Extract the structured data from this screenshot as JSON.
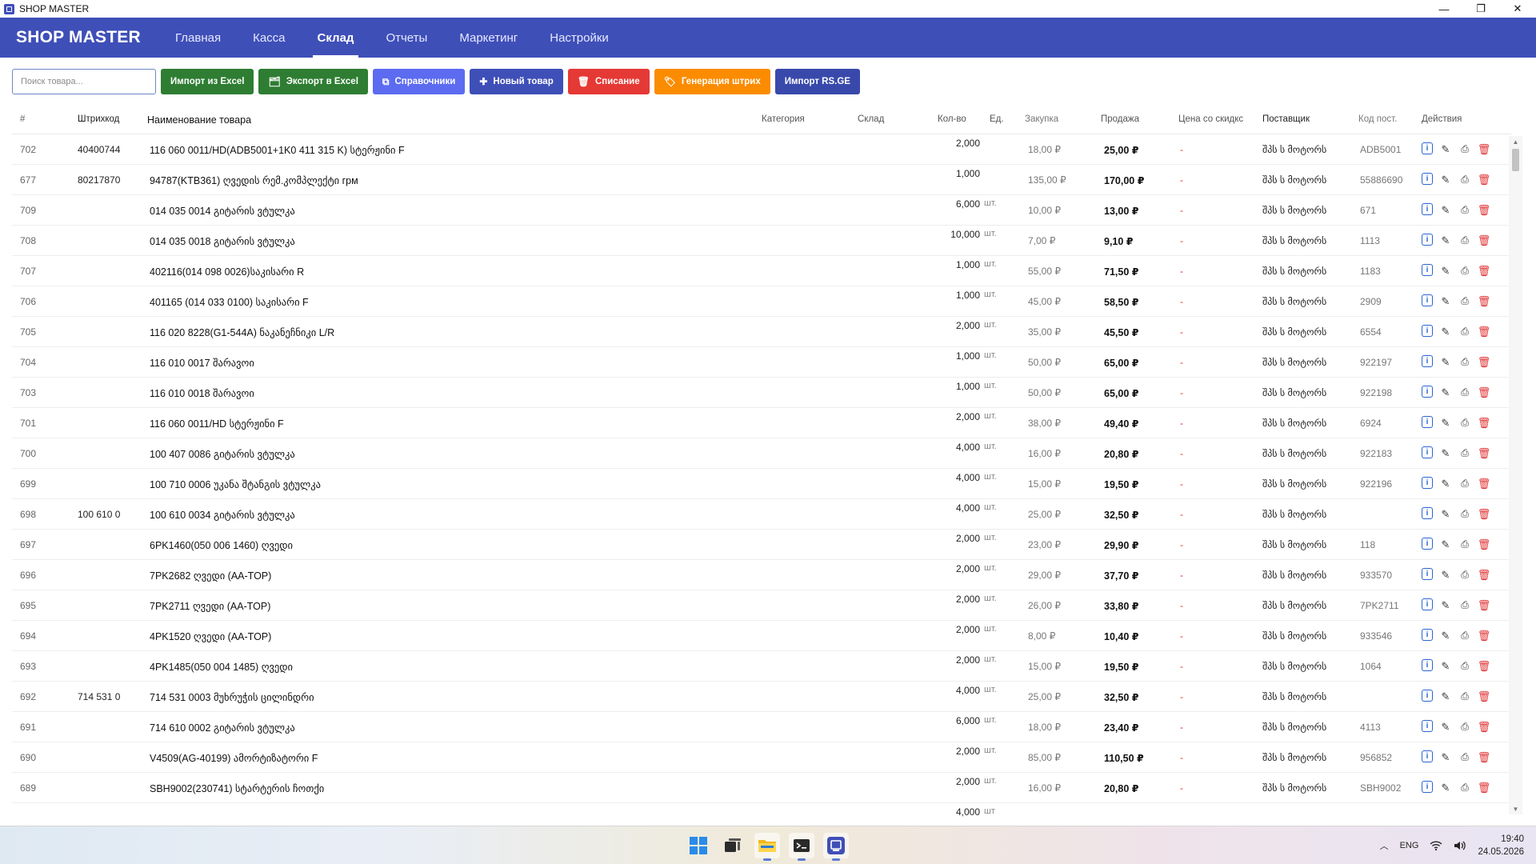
{
  "window": {
    "title": "SHOP MASTER",
    "min": "—",
    "max": "❐",
    "close": "✕"
  },
  "nav": {
    "brand": "SHOP MASTER",
    "items": [
      {
        "label": "Главная",
        "active": false
      },
      {
        "label": "Касса",
        "active": false
      },
      {
        "label": "Склад",
        "active": true
      },
      {
        "label": "Отчеты",
        "active": false
      },
      {
        "label": "Маркетинг",
        "active": false
      },
      {
        "label": "Настройки",
        "active": false
      }
    ]
  },
  "toolbar": {
    "search_placeholder": "Поиск товара...",
    "buttons": [
      {
        "label": "Импорт из Excel",
        "icon": "",
        "color": "#2e7d32"
      },
      {
        "label": "Экспорт в Excel",
        "icon": "🗂",
        "color": "#2e7d32"
      },
      {
        "label": "Справочники",
        "icon": "⧉",
        "color": "#5c6bf0"
      },
      {
        "label": "Новый товар",
        "icon": "✚",
        "color": "#3f4fb8"
      },
      {
        "label": "Списание",
        "icon": "🗑",
        "color": "#e53935"
      },
      {
        "label": "Генерация штрих",
        "icon": "🏷",
        "color": "#fb8c00"
      },
      {
        "label": "Импорт RS.GE",
        "icon": "",
        "color": "#3949ab"
      }
    ]
  },
  "table": {
    "columns": {
      "id": "#",
      "barcode": "Штрихкод",
      "name": "Наименование товара",
      "category": "Категория",
      "warehouse": "Склад",
      "qty": "Кол-во",
      "unit": "Ед.",
      "buy": "Закупка",
      "sell": "Продажа",
      "discount": "Цена со скидкс",
      "supplier": "Поставщик",
      "code": "Код пост.",
      "actions": "Действия"
    },
    "rows": [
      {
        "id": "702",
        "barcode": "40400744",
        "name": "116 060 0011/HD(ADB5001+1K0 411 315 K) სტერჟინი F",
        "qty": "2,000",
        "unit": "",
        "buy": "18,00 ₽",
        "sell": "25,00 ₽",
        "disc": "-",
        "supplier": "შპს ს მოტორს",
        "code": "ADB5001"
      },
      {
        "id": "677",
        "barcode": "80217870",
        "name": "94787(KTB361) ღვედის რემ.კომპლექტი грм",
        "qty": "1,000",
        "unit": "",
        "buy": "135,00 ₽",
        "sell": "170,00 ₽",
        "disc": "-",
        "supplier": "შპს ს მოტორს",
        "code": "55886690"
      },
      {
        "id": "709",
        "barcode": "",
        "name": "014 035 0014 გიტარის ვტულკა",
        "qty": "6,000",
        "unit": "шт.",
        "buy": "10,00 ₽",
        "sell": "13,00 ₽",
        "disc": "-",
        "supplier": "შპს ს მოტორს",
        "code": "671"
      },
      {
        "id": "708",
        "barcode": "",
        "name": "014 035 0018 გიტარის ვტულკა",
        "qty": "10,000",
        "unit": "шт.",
        "buy": "7,00 ₽",
        "sell": "9,10 ₽",
        "disc": "-",
        "supplier": "შპს ს მოტორს",
        "code": "1113"
      },
      {
        "id": "707",
        "barcode": "",
        "name": "402116(014 098 0026)საკისარი R",
        "qty": "1,000",
        "unit": "шт.",
        "buy": "55,00 ₽",
        "sell": "71,50 ₽",
        "disc": "-",
        "supplier": "შპს ს მოტორს",
        "code": "1183"
      },
      {
        "id": "706",
        "barcode": "",
        "name": "401165 (014 033 0100) საკისარი F",
        "qty": "1,000",
        "unit": "шт.",
        "buy": "45,00 ₽",
        "sell": "58,50 ₽",
        "disc": "-",
        "supplier": "შპს ს მოტორს",
        "code": "2909"
      },
      {
        "id": "705",
        "barcode": "",
        "name": "116 020 8228(G1-544A) ნაკანეჩნიკი L/R",
        "qty": "2,000",
        "unit": "шт.",
        "buy": "35,00 ₽",
        "sell": "45,50 ₽",
        "disc": "-",
        "supplier": "შპს ს მოტორს",
        "code": "6554"
      },
      {
        "id": "704",
        "barcode": "",
        "name": "116 010 0017 შარავოი",
        "qty": "1,000",
        "unit": "шт.",
        "buy": "50,00 ₽",
        "sell": "65,00 ₽",
        "disc": "-",
        "supplier": "შპს ს მოტორს",
        "code": "922197"
      },
      {
        "id": "703",
        "barcode": "",
        "name": "116 010 0018 შარავოი",
        "qty": "1,000",
        "unit": "шт.",
        "buy": "50,00 ₽",
        "sell": "65,00 ₽",
        "disc": "-",
        "supplier": "შპს ს მოტორს",
        "code": "922198"
      },
      {
        "id": "701",
        "barcode": "",
        "name": "116 060 0011/HD სტერჟინი F",
        "qty": "2,000",
        "unit": "шт.",
        "buy": "38,00 ₽",
        "sell": "49,40 ₽",
        "disc": "-",
        "supplier": "შპს ს მოტორს",
        "code": "6924"
      },
      {
        "id": "700",
        "barcode": "",
        "name": "100 407 0086 გიტარის ვტულკა",
        "qty": "4,000",
        "unit": "шт.",
        "buy": "16,00 ₽",
        "sell": "20,80 ₽",
        "disc": "-",
        "supplier": "შპს ს მოტორს",
        "code": "922183"
      },
      {
        "id": "699",
        "barcode": "",
        "name": "100 710 0006 უკანა შტანგის ვტულკა",
        "qty": "4,000",
        "unit": "шт.",
        "buy": "15,00 ₽",
        "sell": "19,50 ₽",
        "disc": "-",
        "supplier": "შპს ს მოტორს",
        "code": "922196"
      },
      {
        "id": "698",
        "barcode": "100 610 0",
        "name": "100 610 0034  გიტარის ვტულკა",
        "qty": "4,000",
        "unit": "шт.",
        "buy": "25,00 ₽",
        "sell": "32,50 ₽",
        "disc": "-",
        "supplier": "შპს ს მოტორს",
        "code": ""
      },
      {
        "id": "697",
        "barcode": "",
        "name": "6PK1460(050 006 1460) ღვედი",
        "qty": "2,000",
        "unit": "шт.",
        "buy": "23,00 ₽",
        "sell": "29,90 ₽",
        "disc": "-",
        "supplier": "შპს ს მოტორს",
        "code": "118"
      },
      {
        "id": "696",
        "barcode": "",
        "name": "7PK2682 ღვედი (AA-TOP)",
        "qty": "2,000",
        "unit": "шт.",
        "buy": "29,00 ₽",
        "sell": "37,70 ₽",
        "disc": "-",
        "supplier": "შპს ს მოტორს",
        "code": "933570"
      },
      {
        "id": "695",
        "barcode": "",
        "name": "7PK2711 ღვედი (AA-TOP)",
        "qty": "2,000",
        "unit": "шт.",
        "buy": "26,00 ₽",
        "sell": "33,80 ₽",
        "disc": "-",
        "supplier": "შპს ს მოტორს",
        "code": "7PK2711"
      },
      {
        "id": "694",
        "barcode": "",
        "name": "4PK1520 ღვედი (AA-TOP)",
        "qty": "2,000",
        "unit": "шт.",
        "buy": "8,00 ₽",
        "sell": "10,40 ₽",
        "disc": "-",
        "supplier": "შპს ს მოტორს",
        "code": "933546"
      },
      {
        "id": "693",
        "barcode": "",
        "name": "4PK1485(050 004 1485) ღვედი",
        "qty": "2,000",
        "unit": "шт.",
        "buy": "15,00 ₽",
        "sell": "19,50 ₽",
        "disc": "-",
        "supplier": "შპს ს მოტორს",
        "code": "1064"
      },
      {
        "id": "692",
        "barcode": "714 531 0",
        "name": "714 531 0003 მუხრუჭის ცილინდრი",
        "qty": "4,000",
        "unit": "шт.",
        "buy": "25,00 ₽",
        "sell": "32,50 ₽",
        "disc": "-",
        "supplier": "შპს ს მოტორს",
        "code": ""
      },
      {
        "id": "691",
        "barcode": "",
        "name": "714 610 0002 გიტარის ვტულკა",
        "qty": "6,000",
        "unit": "шт.",
        "buy": "18,00 ₽",
        "sell": "23,40 ₽",
        "disc": "-",
        "supplier": "შპს ს მოტორს",
        "code": "4113"
      },
      {
        "id": "690",
        "barcode": "",
        "name": "V4509(AG-40199) ამორტიზატორი F",
        "qty": "2,000",
        "unit": "шт.",
        "buy": "85,00 ₽",
        "sell": "110,50 ₽",
        "disc": "-",
        "supplier": "შპს ს მოტორს",
        "code": "956852"
      },
      {
        "id": "689",
        "barcode": "",
        "name": "SBH9002(230741) სტარტერის ჩოთქი",
        "qty": "2,000",
        "unit": "шт.",
        "buy": "16,00 ₽",
        "sell": "20,80 ₽",
        "disc": "-",
        "supplier": "შპს ს მოტორს",
        "code": "SBH9002"
      }
    ],
    "partial_row": {
      "qty": "4,000",
      "unit": "шт"
    }
  },
  "taskbar": {
    "lang": "ENG",
    "time": "19:40",
    "date": "24.05.2026"
  }
}
